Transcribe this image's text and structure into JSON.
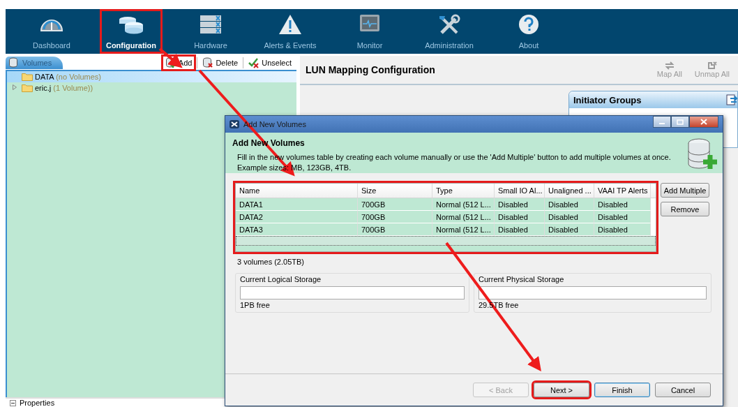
{
  "nav": [
    {
      "label": "Dashboard",
      "kind": "gauge",
      "selected": false,
      "highlighted": false
    },
    {
      "label": "Configuration",
      "kind": "disks",
      "selected": true,
      "highlighted": true
    },
    {
      "label": "Hardware",
      "kind": "server",
      "selected": false,
      "highlighted": false
    },
    {
      "label": "Alerts & Events",
      "kind": "warning",
      "selected": false,
      "highlighted": false
    },
    {
      "label": "Monitor",
      "kind": "monitor",
      "selected": false,
      "highlighted": false
    },
    {
      "label": "Administration",
      "kind": "tools",
      "selected": false,
      "highlighted": false
    },
    {
      "label": "About",
      "kind": "help",
      "selected": false,
      "highlighted": false
    }
  ],
  "volumes_panel": {
    "tab": "Volumes",
    "toolbar": [
      {
        "label": "Add",
        "kind": "add",
        "highlighted": true
      },
      {
        "label": "Delete",
        "kind": "delete",
        "highlighted": false
      },
      {
        "label": "Unselect",
        "kind": "unselect",
        "highlighted": false
      }
    ],
    "tree": [
      {
        "name": "DATA",
        "count": "(no Volumes)",
        "selected": true,
        "expandable": false
      },
      {
        "name": "eric.j",
        "count": "(1 Volume))",
        "selected": false,
        "expandable": true
      }
    ]
  },
  "properties": {
    "label": "Properties"
  },
  "lun_mapping": {
    "title": "LUN Mapping Configuration",
    "actions": [
      {
        "label": "Map All",
        "kind": "map",
        "disabled": true
      },
      {
        "label": "Unmap All",
        "kind": "unmap",
        "disabled": true
      }
    ],
    "initiator_groups": {
      "title": "Initiator Groups"
    }
  },
  "dialog": {
    "title": "Add New Volumes",
    "heading": "Add New Volumes",
    "description": "Fill in the new volumes table by creating each volume manually or use the 'Add Multiple' button to add multiple volumes at once.",
    "example": "Example sizes: MB, 123GB, 4TB.",
    "table": {
      "highlighted": true,
      "columns": [
        "Name",
        "Size",
        "Type",
        "Small IO Al...",
        "Unaligned ...",
        "VAAI TP Alerts"
      ],
      "rows": [
        [
          "DATA1",
          "700GB",
          "Normal (512 L...",
          "Disabled",
          "Disabled",
          "Disabled"
        ],
        [
          "DATA2",
          "700GB",
          "Normal (512 L...",
          "Disabled",
          "Disabled",
          "Disabled"
        ],
        [
          "DATA3",
          "700GB",
          "Normal (512 L...",
          "Disabled",
          "Disabled",
          "Disabled"
        ]
      ]
    },
    "side_buttons": [
      "Add Multiple",
      "Remove"
    ],
    "summary": "3 volumes (2.05TB)",
    "storage": [
      {
        "label": "Current Logical Storage",
        "free": "1PB free"
      },
      {
        "label": "Current Physical Storage",
        "free": "29.5TB free"
      }
    ],
    "buttons": [
      {
        "label": "< Back",
        "disabled": true,
        "default": false,
        "highlighted": false
      },
      {
        "label": "Next >",
        "disabled": false,
        "default": false,
        "highlighted": true
      },
      {
        "label": "Finish",
        "disabled": false,
        "default": true,
        "highlighted": false
      },
      {
        "label": "Cancel",
        "disabled": false,
        "default": false,
        "highlighted": false
      }
    ]
  }
}
